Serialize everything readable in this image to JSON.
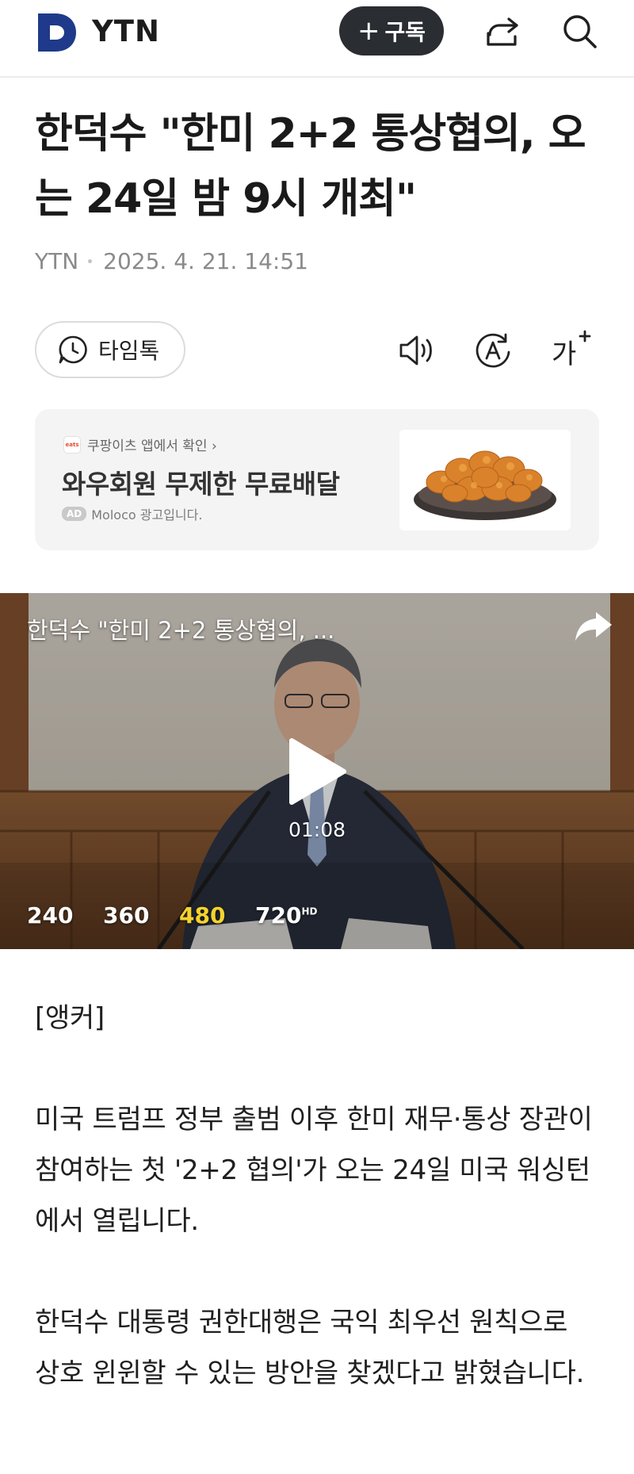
{
  "header": {
    "brand": "YTN",
    "subscribe_label": "구독",
    "icons": {
      "share": "share-icon",
      "search": "search-icon"
    }
  },
  "article": {
    "headline": "한덕수 \"한미 2+2 통상협의, 오는 24일 밤 9시 개최\"",
    "source": "YTN",
    "datetime": "2025. 4. 21. 14:51",
    "talk_label": "타임톡"
  },
  "ad": {
    "source_label": "쿠팡이츠 앱에서 확인 ›",
    "eats_mark": "eats",
    "title": "와우회원 무제한 무료배달",
    "badge": "AD",
    "note": "Moloco 광고입니다."
  },
  "video": {
    "title": "한덕수 \"한미 2+2 통상협의, ...",
    "duration": "01:08",
    "qualities": [
      "240",
      "360",
      "480",
      "720"
    ],
    "selected_quality": "480",
    "hd_mark": "HD"
  },
  "body": {
    "paragraphs": [
      "[앵커]",
      "미국 트럼프 정부 출범 이후 한미 재무·통상 장관이 참여하는 첫 '2+2 협의'가 오는 24일 미국 워싱턴에서 열립니다.",
      "한덕수 대통령 권한대행은 국익 최우선 원칙으로 상호 윈윈할 수 있는 방안을 찾겠다고 밝혔습니다."
    ]
  },
  "colors": {
    "accent": "#2a2d31",
    "selected_quality": "#f6d32d",
    "brand": "#1f3a8a"
  }
}
